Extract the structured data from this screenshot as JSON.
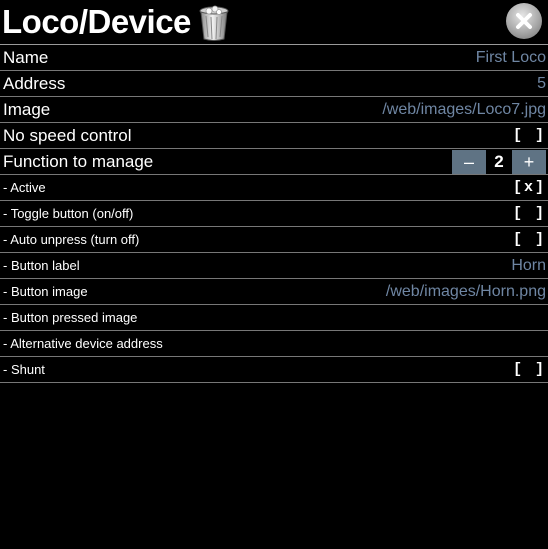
{
  "header": {
    "title": "Loco/Device"
  },
  "rows": [
    {
      "label": "Name",
      "value": "First Loco"
    },
    {
      "label": "Address",
      "value": "5"
    },
    {
      "label": "Image",
      "value": "/web/images/Loco7.jpg"
    },
    {
      "label": "No speed control",
      "checkbox": "[ ]"
    },
    {
      "label": "Function to manage",
      "stepper": {
        "minus": "–",
        "value": "2",
        "plus": "+"
      }
    },
    {
      "label": "- Active",
      "checkbox": "[x]"
    },
    {
      "label": "- Toggle button (on/off)",
      "checkbox": "[ ]"
    },
    {
      "label": "- Auto unpress (turn off)",
      "checkbox": "[ ]"
    },
    {
      "label": "- Button label",
      "value": "Horn"
    },
    {
      "label": "- Button image",
      "value": "/web/images/Horn.png"
    },
    {
      "label": "- Button pressed image",
      "value": ""
    },
    {
      "label": "- Alternative device address",
      "value": ""
    },
    {
      "label": "- Shunt",
      "checkbox": "[ ]"
    }
  ]
}
